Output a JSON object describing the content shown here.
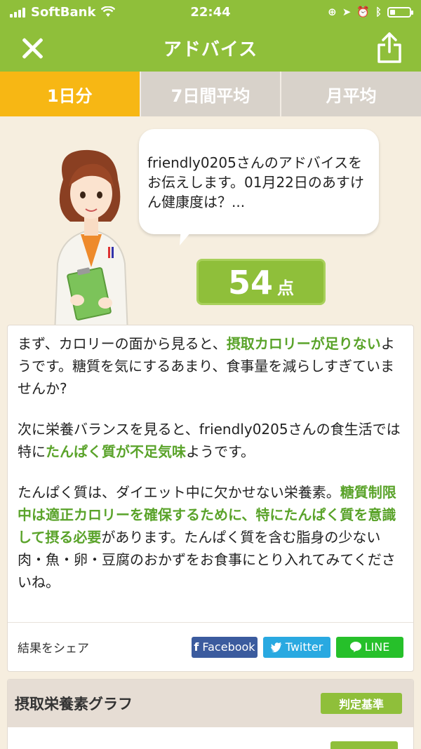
{
  "status_bar": {
    "carrier": "SoftBank",
    "time": "22:44",
    "battery_level": 0.25
  },
  "nav": {
    "title": "アドバイス",
    "close_icon": "close-icon",
    "share_icon": "share-icon"
  },
  "tabs": [
    {
      "label": "1日分",
      "active": true
    },
    {
      "label": "7日間平均",
      "active": false
    },
    {
      "label": "月平均",
      "active": false
    }
  ],
  "advisor": {
    "bubble_text": "friendly0205さんのアドバイスをお伝えします。01月22日のあすけん健康度は？...",
    "score": "54",
    "score_unit": "点"
  },
  "advice": {
    "p1_a": "まず、カロリーの面から見ると、",
    "p1_hl": "摂取カロリーが足りない",
    "p1_b": "ようです。糖質を気にするあまり、食事量を減らしすぎていませんか?",
    "p2_a": "次に栄養バランスを見ると、friendly0205さんの食生活では特に",
    "p2_hl": "たんぱく質が不足気味",
    "p2_b": "ようです。",
    "p3_a": "たんぱく質は、ダイエット中に欠かせない栄養素。",
    "p3_hl": "糖質制限中は適正カロリーを確保するために、特にたんぱく質を意識して摂る必要",
    "p3_b": "があります。たんぱく質を含む脂身の少ない肉・魚・卵・豆腐のおかずをお食事にとり入れてみてくださいね。"
  },
  "share": {
    "label": "結果をシェア",
    "facebook": "Facebook",
    "twitter": "Twitter",
    "line": "LINE"
  },
  "nutrition": {
    "title": "摂取栄養素グラフ",
    "criteria_button": "判定基準"
  },
  "colors": {
    "brand_green": "#8fbf3a",
    "active_tab": "#f7b714",
    "highlight": "#5aa32a",
    "facebook": "#3b5b9e",
    "twitter": "#29a9e1",
    "line": "#26c02a"
  }
}
